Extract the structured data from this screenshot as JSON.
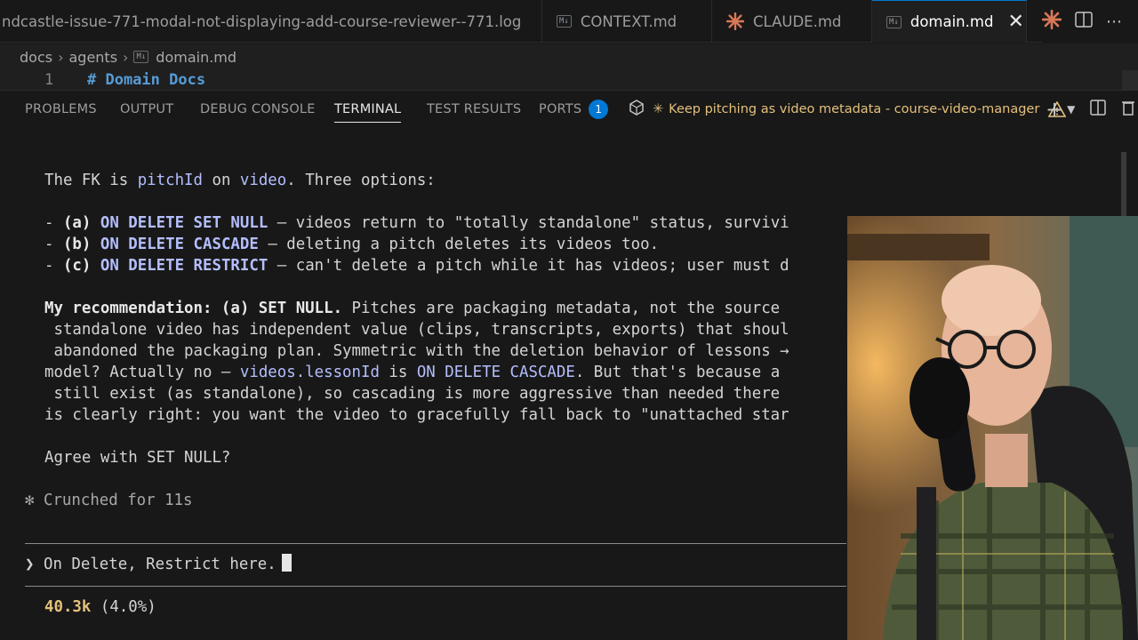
{
  "tabs": [
    {
      "label": "ndcastle-issue-771-modal-not-displaying-add-course-reviewer--771.log",
      "icon": "log-file-icon"
    },
    {
      "label": "CONTEXT.md",
      "icon": "markdown-icon"
    },
    {
      "label": "CLAUDE.md",
      "icon": "claude-star-icon"
    },
    {
      "label": "domain.md",
      "icon": "markdown-icon",
      "active": true
    }
  ],
  "breadcrumb": {
    "parts": [
      "docs",
      "agents",
      "domain.md"
    ],
    "file_badge": "M↓"
  },
  "editor": {
    "line_number": "1",
    "line_text": "# Domain Docs"
  },
  "panel": {
    "tabs": [
      "PROBLEMS",
      "OUTPUT",
      "DEBUG CONSOLE",
      "TERMINAL",
      "TEST RESULTS",
      "PORTS"
    ],
    "ports_badge": "1",
    "terminal_name": "Keep pitching as video metadata - course-video-manager"
  },
  "terminal": {
    "l1": {
      "a": "The FK is ",
      "b": "pitchId",
      "c": " on ",
      "d": "video",
      "e": ". Three options:"
    },
    "opt_a": {
      "dash": "- ",
      "label": "(a)",
      "kw": " ON DELETE SET NULL",
      "text": " — videos return to \"totally standalone\" status, survivi"
    },
    "opt_b": {
      "dash": "- ",
      "label": "(b)",
      "kw": " ON DELETE CASCADE",
      "text": " — deleting a pitch deletes its videos too."
    },
    "opt_c": {
      "dash": "- ",
      "label": "(c)",
      "kw": " ON DELETE RESTRICT",
      "text": " — can't delete a pitch while it has videos; user must d"
    },
    "rec1": {
      "bold": "My recommendation: (a) SET NULL.",
      "text": " Pitches are packaging metadata, not the source"
    },
    "rec2": " standalone video has independent value (clips, transcripts, exports) that shoul",
    "rec3": " abandoned the packaging plan. Symmetric with the deletion behavior of lessons →",
    "rec4": {
      "a": "model? Actually no — ",
      "b": "videos.lessonId",
      "c": " is ",
      "d": "ON DELETE CASCADE",
      "e": ". But that's because a"
    },
    "rec5": " still exist (as standalone), so cascading is more aggressive than needed there",
    "rec6": "is clearly right: you want the video to gracefully fall back to \"unattached star",
    "agree": "Agree with SET NULL?",
    "crunch": {
      "symbol": "✻",
      "text": "Crunched for 11s"
    },
    "prompt": {
      "symbol": "❯",
      "text": "On Delete, Restrict here."
    },
    "tokens": {
      "count": "40.3k",
      "percent": "(4.0%)"
    }
  },
  "colors": {
    "accent": "#0078d4",
    "keyword": "#b4befe",
    "claude": "#d97757",
    "warning": "#e5c07b"
  }
}
